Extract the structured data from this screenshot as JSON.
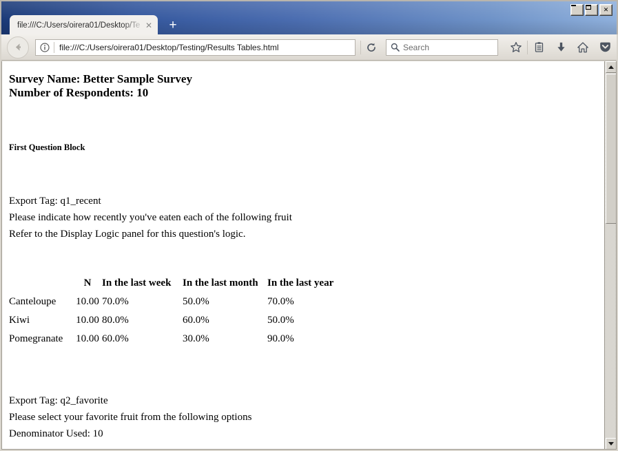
{
  "window": {
    "controls": {
      "minimize_label": "_",
      "maximize_label": "□",
      "close_label": "✕"
    }
  },
  "tabs": {
    "active": {
      "title": "file:///C:/Users/oirera01/Desktop/Te",
      "close_label": "✕"
    },
    "new_tab_label": "+"
  },
  "toolbar": {
    "back_icon": "back-arrow-icon",
    "identity_icon": "info-icon",
    "url": "file:///C:/Users/oirera01/Desktop/Testing/Results Tables.html",
    "reload_icon": "reload-icon",
    "search_placeholder": "Search",
    "search_icon": "search-icon",
    "bookmark_icon": "star-icon",
    "readinglist_icon": "reading-list-icon",
    "downloads_icon": "download-icon",
    "home_icon": "home-icon",
    "pocket_icon": "pocket-icon",
    "menu_icon": "hamburger-menu-icon"
  },
  "page": {
    "survey_name_line": "Survey Name: Better Sample Survey",
    "respondents_line": "Number of Respondents: 10",
    "block_heading": "First Question Block",
    "q1": {
      "export_tag": "Export Tag: q1_recent",
      "prompt": "Please indicate how recently you've eaten each of the following fruit",
      "logic_note": "Refer to the Display Logic panel for this question's logic.",
      "table": {
        "headers": [
          "",
          "N",
          "In the last week",
          "In the last month",
          "In the last year"
        ],
        "rows": [
          {
            "label": "Canteloupe",
            "n": "10.00",
            "v1": "70.0%",
            "v2": "50.0%",
            "v3": "70.0%"
          },
          {
            "label": "Kiwi",
            "n": "10.00",
            "v1": "80.0%",
            "v2": "60.0%",
            "v3": "50.0%"
          },
          {
            "label": "Pomegranate",
            "n": "10.00",
            "v1": "60.0%",
            "v2": "30.0%",
            "v3": "90.0%"
          }
        ]
      }
    },
    "q2": {
      "export_tag": "Export Tag: q2_favorite",
      "prompt": "Please select your favorite fruit from the following options",
      "denominator": "Denominator Used: 10"
    }
  },
  "scrollbar": {
    "up_arrow": "scroll-up-icon",
    "down_arrow": "scroll-down-icon"
  }
}
